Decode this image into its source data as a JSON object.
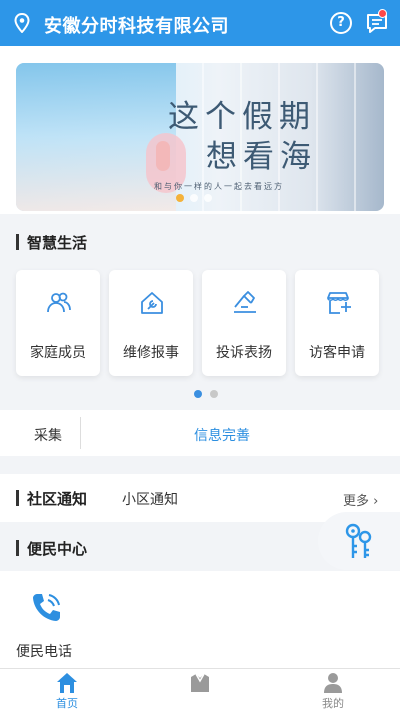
{
  "header": {
    "title": "安徽分时科技有限公司",
    "help_symbol": "?"
  },
  "banner": {
    "line1": "这个假期",
    "line2": "想看海",
    "tagline": "和与你一样的人一起去看远方"
  },
  "smart_life": {
    "title": "智慧生活",
    "items": [
      {
        "label": "家庭成员",
        "icon": "family-icon"
      },
      {
        "label": "维修报事",
        "icon": "repair-icon"
      },
      {
        "label": "投诉表扬",
        "icon": "complaint-icon"
      },
      {
        "label": "访客申请",
        "icon": "visitor-icon"
      }
    ]
  },
  "collect": {
    "label": "采集",
    "value": "信息完善"
  },
  "notice": {
    "title": "社区通知",
    "subtitle": "小区通知",
    "more": "更多 ›"
  },
  "convenience": {
    "title": "便民中心",
    "items": [
      {
        "label": "便民电话",
        "icon": "phone-icon"
      }
    ]
  },
  "tabs": [
    {
      "label": "首页",
      "icon": "home-icon",
      "active": true
    },
    {
      "label": "",
      "icon": "store-icon",
      "active": false
    },
    {
      "label": "我的",
      "icon": "user-icon",
      "active": false
    }
  ],
  "colors": {
    "primary": "#2d96e8",
    "accent_link": "#2d8fe0",
    "badge": "#ff4747"
  }
}
